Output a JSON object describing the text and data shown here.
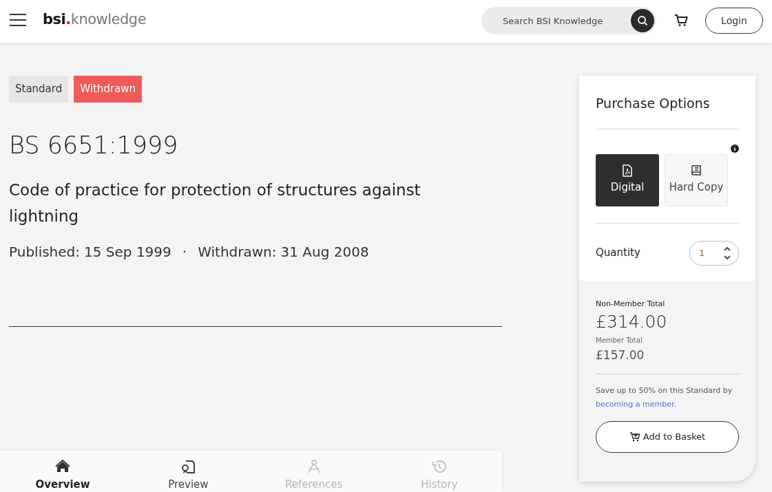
{
  "header": {
    "logo": {
      "brand": "bsi",
      "dot": ".",
      "product": "knowledge"
    },
    "search": {
      "placeholder": "Search BSI Knowledge"
    },
    "login": "Login"
  },
  "badges": [
    {
      "label": "Standard",
      "kind": "type"
    },
    {
      "label": "Withdrawn",
      "kind": "status"
    }
  ],
  "standard": {
    "code": "BS 6651:1999",
    "title": "Code of practice for protection of structures against lightning",
    "published_label": "Published:",
    "published": "15 Sep 1999",
    "separator": "·",
    "withdrawn_label": "Withdrawn:",
    "withdrawn": "31 Aug 2008"
  },
  "tabs": [
    {
      "label": "Overview",
      "kind": "home",
      "selected": true,
      "disabled": false
    },
    {
      "label": "Preview",
      "kind": "preview",
      "selected": false,
      "disabled": false
    },
    {
      "label": "References",
      "kind": "references",
      "selected": false,
      "disabled": true
    },
    {
      "label": "History",
      "kind": "history",
      "selected": false,
      "disabled": true
    }
  ],
  "purchase": {
    "title": "Purchase Options",
    "formats": [
      {
        "label": "Digital",
        "kind": "pdf",
        "selected": true
      },
      {
        "label": "Hard Copy",
        "kind": "book",
        "selected": false
      }
    ],
    "quantity_label": "Quantity",
    "quantity": "1",
    "non_member_label": "Non-Member Total",
    "non_member_price": "£314.00",
    "member_label": "Member Total",
    "member_price": "£157.00",
    "save_text": "Save up to 50% on this Standard by",
    "save_link": "becoming a member.",
    "add_button": "Add to Basket"
  }
}
